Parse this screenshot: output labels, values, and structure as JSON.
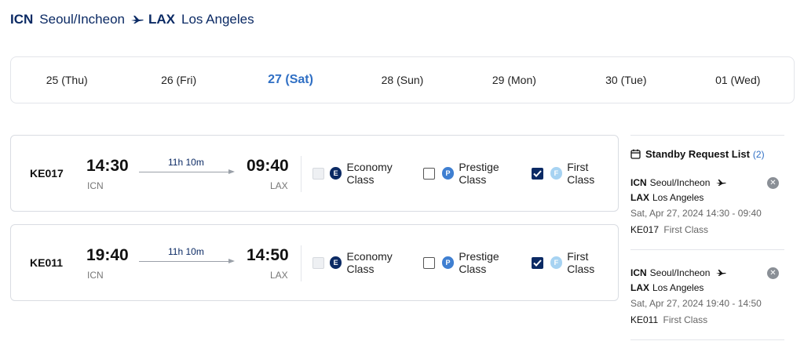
{
  "route": {
    "origin_code": "ICN",
    "origin_city": "Seoul/Incheon",
    "dest_code": "LAX",
    "dest_city": "Los Angeles"
  },
  "dates": [
    {
      "label": "25 (Thu)",
      "active": false
    },
    {
      "label": "26 (Fri)",
      "active": false
    },
    {
      "label": "27 (Sat)",
      "active": true
    },
    {
      "label": "28 (Sun)",
      "active": false
    },
    {
      "label": "29 (Mon)",
      "active": false
    },
    {
      "label": "30 (Tue)",
      "active": false
    },
    {
      "label": "01 (Wed)",
      "active": false
    }
  ],
  "flights": [
    {
      "number": "KE017",
      "dep_time": "14:30",
      "dep_code": "ICN",
      "duration": "11h 10m",
      "arr_time": "09:40",
      "arr_code": "LAX",
      "classes": [
        {
          "badge": "E",
          "label": "Economy Class",
          "state": "disabled"
        },
        {
          "badge": "P",
          "label": "Prestige Class",
          "state": "unchecked"
        },
        {
          "badge": "F",
          "label": "First Class",
          "state": "checked"
        }
      ]
    },
    {
      "number": "KE011",
      "dep_time": "19:40",
      "dep_code": "ICN",
      "duration": "11h 10m",
      "arr_time": "14:50",
      "arr_code": "LAX",
      "classes": [
        {
          "badge": "E",
          "label": "Economy Class",
          "state": "disabled"
        },
        {
          "badge": "P",
          "label": "Prestige Class",
          "state": "unchecked"
        },
        {
          "badge": "F",
          "label": "First Class",
          "state": "checked"
        }
      ]
    }
  ],
  "standby": {
    "title": "Standby Request List",
    "count": "(2)",
    "requests": [
      {
        "origin_code": "ICN",
        "origin_city": "Seoul/Incheon",
        "dest_code": "LAX",
        "dest_city": "Los Angeles",
        "datetime": "Sat, Apr 27, 2024 14:30 - 09:40",
        "flight": "KE017",
        "class": "First Class"
      },
      {
        "origin_code": "ICN",
        "origin_city": "Seoul/Incheon",
        "dest_code": "LAX",
        "dest_city": "Los Angeles",
        "datetime": "Sat, Apr 27, 2024 19:40 - 14:50",
        "flight": "KE011",
        "class": "First Class"
      }
    ]
  },
  "icons": {
    "plane": "airplane-icon",
    "calendar": "calendar-icon",
    "remove": "close-circle-icon",
    "check": "checkmark-icon"
  },
  "colors": {
    "brand_navy": "#0b2a64",
    "active_date": "#2f6fc4",
    "prestige_badge": "#3f7fd1",
    "first_badge": "#a7d3f2"
  }
}
